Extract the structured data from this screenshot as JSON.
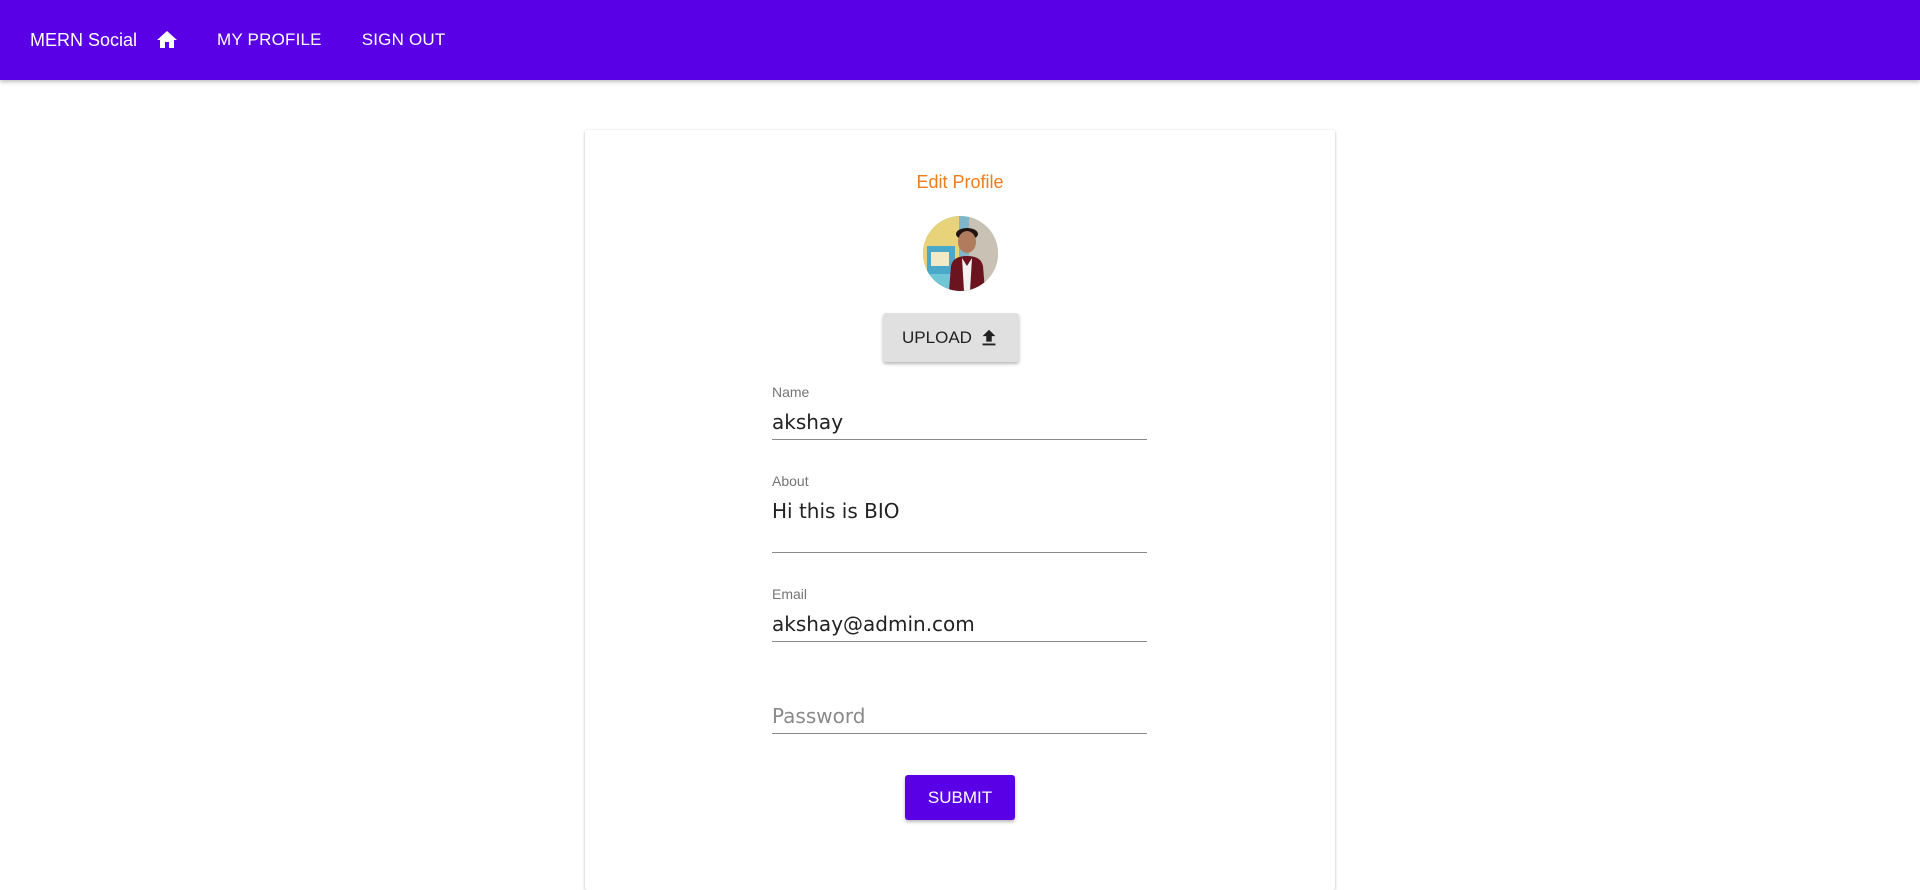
{
  "appbar": {
    "title": "MERN Social",
    "home_icon": "home-icon",
    "nav": [
      {
        "label": "MY PROFILE"
      },
      {
        "label": "SIGN OUT"
      }
    ],
    "color": "#5a00e6"
  },
  "form": {
    "title": "Edit Profile",
    "title_color": "#ef7d1a",
    "upload_label": "UPLOAD",
    "upload_icon": "upload-icon",
    "fields": {
      "name": {
        "label": "Name",
        "value": "akshay"
      },
      "about": {
        "label": "About",
        "value": "Hi this is BIO"
      },
      "email": {
        "label": "Email",
        "value": "akshay@admin.com"
      },
      "password": {
        "placeholder": "Password",
        "value": ""
      }
    },
    "submit_label": "SUBMIT"
  }
}
